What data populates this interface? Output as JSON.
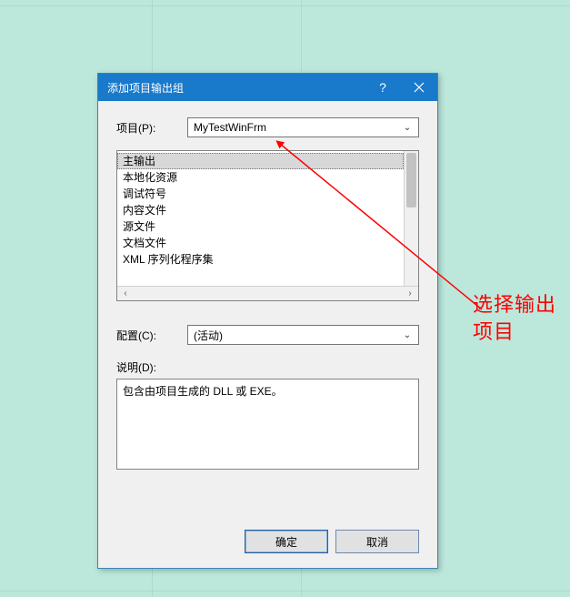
{
  "dialog": {
    "title": "添加项目输出组",
    "project_label": "项目(P):",
    "project_value": "MyTestWinFrm",
    "list_items": [
      "主输出",
      "本地化资源",
      "调试符号",
      "内容文件",
      "源文件",
      "文档文件",
      "XML 序列化程序集"
    ],
    "config_label": "配置(C):",
    "config_value": "(活动)",
    "description_label": "说明(D):",
    "description_value": "包含由项目生成的 DLL 或 EXE。",
    "ok_label": "确定",
    "cancel_label": "取消"
  },
  "annotation": {
    "text": "选择输出项目"
  },
  "icons": {
    "help": "?",
    "close": "×",
    "dropdown": "⌄",
    "left": "‹",
    "right": "›"
  }
}
